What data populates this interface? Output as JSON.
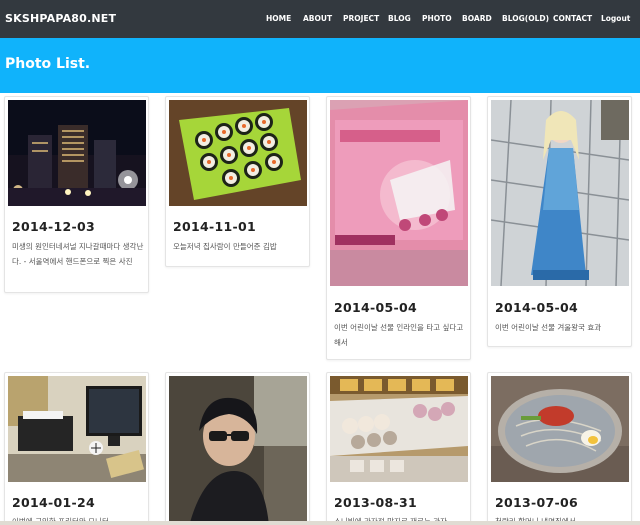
{
  "site": {
    "brand": "SKSHPAPA80.NET"
  },
  "nav": {
    "items": [
      "HOME",
      "ABOUT",
      "PROJECT",
      "BLOG",
      "PHOTO",
      "BOARD",
      "BLOG(OLD)",
      "CONTACT",
      "Logout"
    ]
  },
  "header": {
    "title": "Photo List."
  },
  "photos": [
    {
      "date": "2014-12-03",
      "desc": "미생의 원인터네셔널 지나갈때마다 생각난다. - 서울역에서 핸드폰으로 찍은 사진"
    },
    {
      "date": "2014-11-01",
      "desc": "오늘저녁 집사람이 만들어준 김밥"
    },
    {
      "date": "2014-05-04",
      "desc": "이번 어린이날 선물 인라인을 타고 싶다고 해서"
    },
    {
      "date": "2014-05-04",
      "desc": "이번 어린이날 선물 겨울왕국 효과"
    },
    {
      "date": "2014-01-24",
      "desc": "이번에 구입한 프린터와 모니터"
    },
    {
      "date": "",
      "desc": ""
    },
    {
      "date": "2013-08-31",
      "desc": "소니빌에 과자전 맛지로 재료는 과자"
    },
    {
      "date": "2013-07-06",
      "desc": "청량리 할머니 냉면집에서"
    }
  ]
}
